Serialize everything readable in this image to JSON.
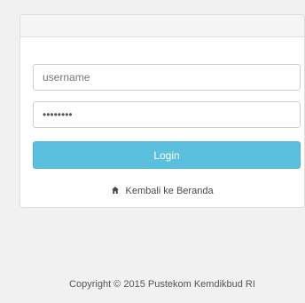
{
  "login": {
    "username_placeholder": "username",
    "password_value": "********",
    "login_button_label": "Login",
    "home_link_label": "Kembali ke Beranda",
    "home_icon": "home-icon"
  },
  "footer": {
    "copyright": "Copyright © 2015 Pustekom Kemdikbud RI"
  },
  "colors": {
    "button": "#5bc0de",
    "background": "#f1f1f1"
  }
}
